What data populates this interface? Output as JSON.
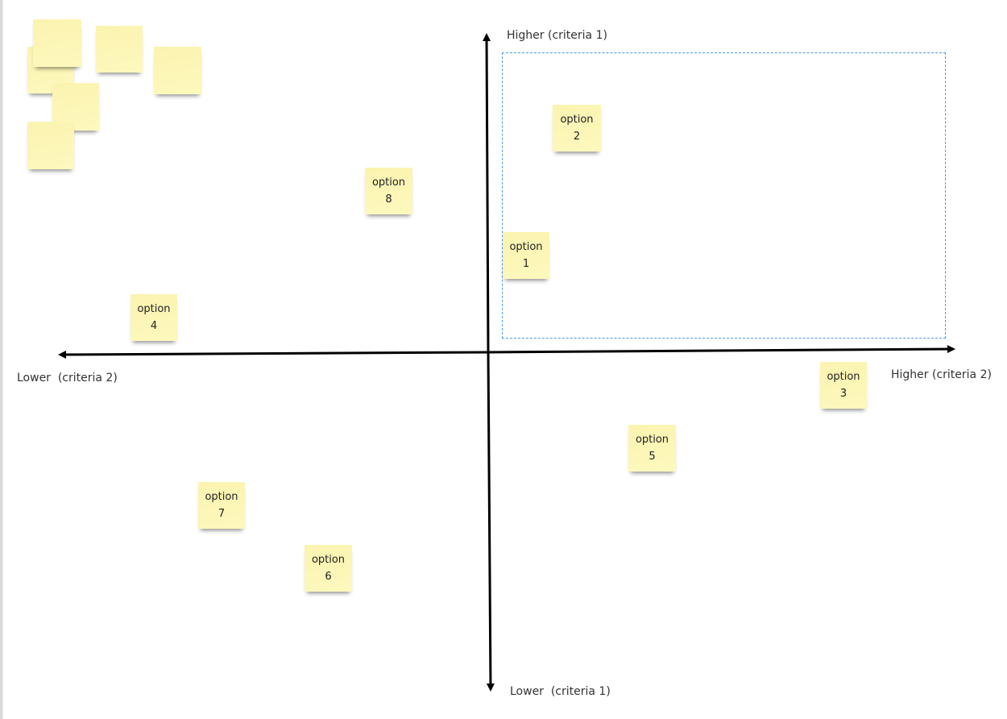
{
  "board": {
    "axes": {
      "vertical_top_label": "Higher (criteria 1)",
      "vertical_bottom_label": "Lower  (criteria 1)",
      "horizontal_left_label": "Lower  (criteria 2)",
      "horizontal_right_label": "Higher (criteria 2)"
    },
    "selection_color": "#4a9be8",
    "sticky_color": "#fcf5b6",
    "stickies": [
      {
        "word": "option",
        "number": "1",
        "quadrant": "higher c1 / higher c2"
      },
      {
        "word": "option",
        "number": "2",
        "quadrant": "higher c1 / higher c2"
      },
      {
        "word": "option",
        "number": "3",
        "quadrant": "lower c1 / higher c2"
      },
      {
        "word": "option",
        "number": "4",
        "quadrant": "higher c1 / lower c2"
      },
      {
        "word": "option",
        "number": "5",
        "quadrant": "lower c1 / higher c2"
      },
      {
        "word": "option",
        "number": "6",
        "quadrant": "lower c1 / lower c2"
      },
      {
        "word": "option",
        "number": "7",
        "quadrant": "lower c1 / lower c2"
      },
      {
        "word": "option",
        "number": "8",
        "quadrant": "higher c1 / lower c2"
      }
    ],
    "blank_sticky_count": 6
  }
}
